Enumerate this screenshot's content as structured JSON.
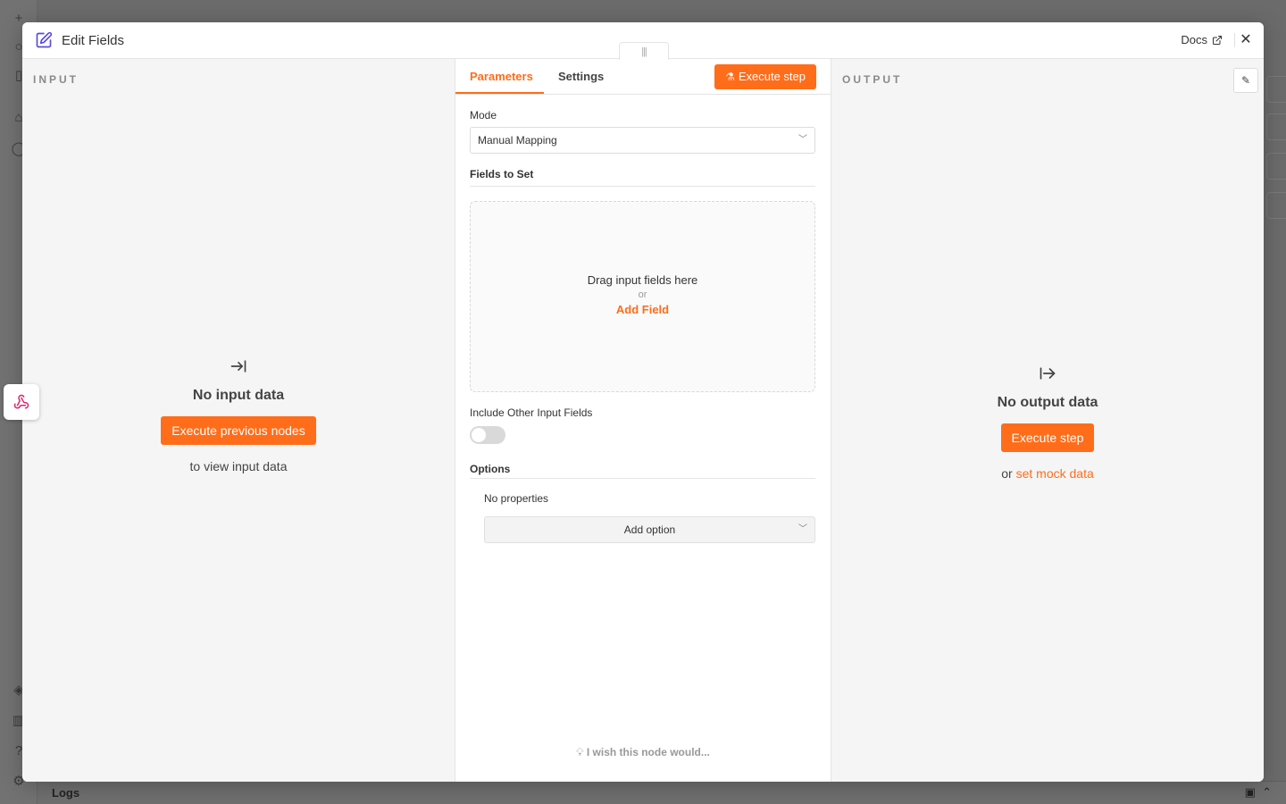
{
  "background": {
    "logs_label": "Logs"
  },
  "modal": {
    "title": "Edit Fields",
    "docs_label": "Docs",
    "close_label": "✕"
  },
  "input_panel": {
    "label": "INPUT",
    "empty_title": "No input data",
    "execute_button": "Execute previous nodes",
    "subtitle": "to view input data"
  },
  "params_panel": {
    "tabs": [
      {
        "label": "Parameters",
        "active": true
      },
      {
        "label": "Settings",
        "active": false
      }
    ],
    "execute_step_label": "Execute step",
    "mode_label": "Mode",
    "mode_value": "Manual Mapping",
    "fields_to_set_label": "Fields to Set",
    "dropzone": {
      "title": "Drag input fields here",
      "or": "or",
      "add_field": "Add Field"
    },
    "include_other_label": "Include Other Input Fields",
    "include_other_enabled": false,
    "options_label": "Options",
    "no_properties": "No properties",
    "add_option_label": "Add option",
    "wish_label": "I wish this node would..."
  },
  "output_panel": {
    "label": "OUTPUT",
    "empty_title": "No output data",
    "execute_button": "Execute step",
    "or_text": "or",
    "mock_link": "set mock data"
  },
  "colors": {
    "accent": "#ff6d1a",
    "panel_bg": "#f5f5f5"
  }
}
